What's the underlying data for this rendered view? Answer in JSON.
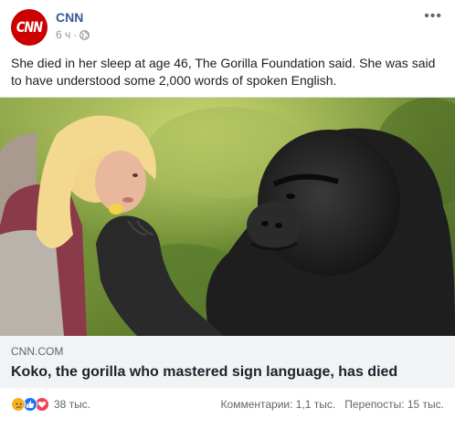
{
  "post": {
    "page_name": "CNN",
    "avatar_text": "CNN",
    "time": "6 ч",
    "separator": "·",
    "more_label": "•••",
    "message": "She died in her sleep at age 46, The Gorilla Foundation said. She was said to have understood some 2,000 words of spoken English."
  },
  "link": {
    "domain": "CNN.COM",
    "title": "Koko, the gorilla who mastered sign language, has died"
  },
  "footer": {
    "reaction_icons": [
      "sad-icon",
      "like-icon",
      "love-icon"
    ],
    "reaction_count": "38 тыс.",
    "comments": "Комментарии: 1,1 тыс.",
    "shares": "Перепосты: 15 тыс."
  },
  "colors": {
    "brand_red": "#cc0000",
    "page_link": "#385898",
    "like_blue": "#1877f2",
    "love_red": "#f33e58",
    "sad_yellow": "#f7b125"
  }
}
